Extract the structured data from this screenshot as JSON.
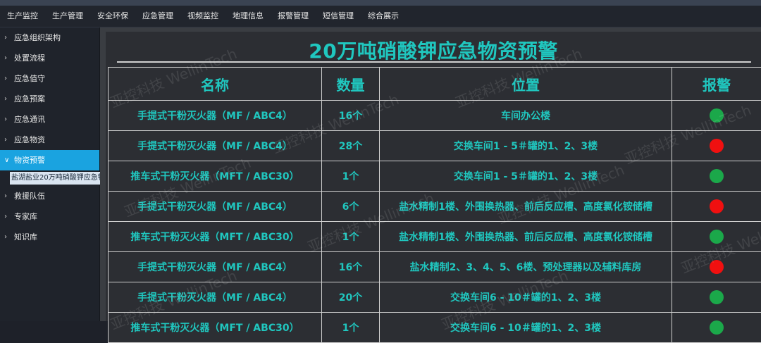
{
  "top_nav": [
    "生产监控",
    "生产管理",
    "安全环保",
    "应急管理",
    "视频监控",
    "地理信息",
    "报警管理",
    "短信管理",
    "综合展示"
  ],
  "sidebar": {
    "items_before": [
      "应急组织架构",
      "处置流程",
      "应急值守",
      "应急预案",
      "应急通讯",
      "应急物资"
    ],
    "active": "物资预警",
    "sub_item": "盐湖盐业20万吨硝酸钾应急物资",
    "items_after": [
      "救援队伍",
      "专家库",
      "知识库"
    ]
  },
  "page": {
    "title": "20万吨硝酸钾应急物资预警",
    "headers": [
      "名称",
      "数量",
      "位置",
      "报警"
    ]
  },
  "rows": [
    {
      "name": "手提式干粉灭火器（MF / ABC4）",
      "qty": "16个",
      "location": "车间办公楼",
      "alarm": "green"
    },
    {
      "name": "手提式干粉灭火器（MF / ABC4）",
      "qty": "28个",
      "location": "交换车间1 - 5＃罐的1、2、3楼",
      "alarm": "red"
    },
    {
      "name": "推车式干粉灭火器（MFT / ABC30）",
      "qty": "1个",
      "location": "交换车间1 - 5＃罐的1、2、3楼",
      "alarm": "green"
    },
    {
      "name": "手提式干粉灭火器（MF / ABC4）",
      "qty": "6个",
      "location": "盐水精制1楼、外围换热器、前后反应槽、高度氯化铵储槽",
      "alarm": "red"
    },
    {
      "name": "推车式干粉灭火器（MFT / ABC30）",
      "qty": "1个",
      "location": "盐水精制1楼、外围换热器、前后反应槽、高度氯化铵储槽",
      "alarm": "green"
    },
    {
      "name": "手提式干粉灭火器（MF / ABC4）",
      "qty": "16个",
      "location": "盐水精制2、3、4、5、6楼、预处理器以及辅料库房",
      "alarm": "red"
    },
    {
      "name": "手提式干粉灭火器（MF / ABC4）",
      "qty": "20个",
      "location": "交换车间6 - 10＃罐的1、2、3楼",
      "alarm": "green"
    },
    {
      "name": "推车式干粉灭火器（MFT / ABC30）",
      "qty": "1个",
      "location": "交换车间6 - 10＃罐的1、2、3楼",
      "alarm": "green"
    }
  ],
  "colors": {
    "accent": "#20c7bf",
    "active": "#1aa3e0",
    "green": "#1ba84a",
    "red": "#f01010"
  },
  "watermark": "亚控科技 WellinTech"
}
